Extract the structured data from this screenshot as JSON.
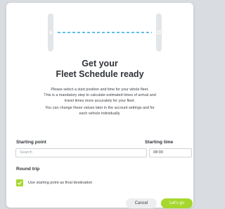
{
  "title": {
    "line1": "Get your",
    "line2": "Fleet Schedule ready"
  },
  "description": {
    "line1": "Please select a start position and time for your whole fleet.",
    "line2": "This is a mandatory step to calculate estimated times of arrival and",
    "line3": "travel times more accurately for your fleet.",
    "line4": "You can change these values later in the account settings and for",
    "line5": "each vehicle individually."
  },
  "form": {
    "starting_point_label": "Starting point",
    "starting_point_placeholder": "Search",
    "starting_time_label": "Starting time",
    "starting_time_value": "08:00",
    "round_trip_label": "Round trip",
    "round_trip_checkbox_label": "Use starting point as final destination",
    "round_trip_checked": true
  },
  "buttons": {
    "cancel": "Cancel",
    "confirm": "Let's go"
  },
  "colors": {
    "accent": "#a6d72e",
    "route_dash": "#2aa8e0",
    "text": "#2f3338"
  },
  "icons": {
    "start_marker": "start-flag-icon",
    "end_marker": "end-flag-icon",
    "check": "check-icon"
  }
}
